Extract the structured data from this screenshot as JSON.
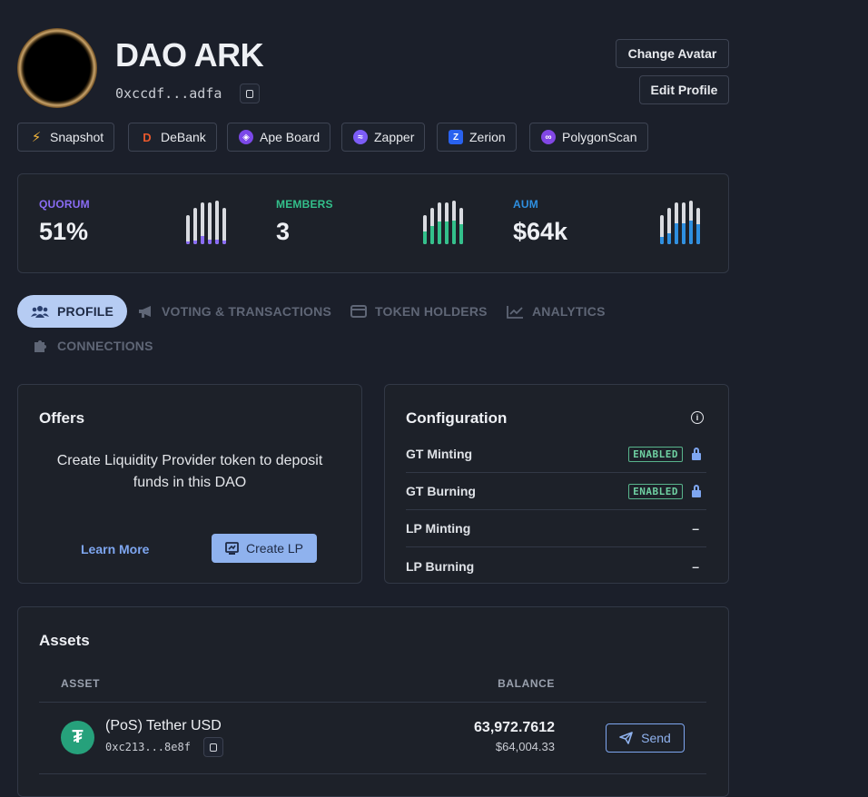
{
  "dao": {
    "title": "DAO ARK",
    "address": "0xccdf...adfa"
  },
  "header_buttons": {
    "change_avatar": "Change Avatar",
    "edit_profile": "Edit Profile"
  },
  "links": [
    {
      "label": "Snapshot",
      "icon": "lightning-icon",
      "color": "#f5b73b"
    },
    {
      "label": "DeBank",
      "icon": "debank-icon",
      "color": "#e8582c"
    },
    {
      "label": "Ape Board",
      "icon": "ape-board-icon",
      "color": "#7b48e8"
    },
    {
      "label": "Zapper",
      "icon": "zapper-icon",
      "color": "#7c5cf6"
    },
    {
      "label": "Zerion",
      "icon": "zerion-icon",
      "color": "#2962ef"
    },
    {
      "label": "PolygonScan",
      "icon": "polygon-icon",
      "color": "#8247e5"
    }
  ],
  "stats": [
    {
      "label": "QUORUM",
      "value": "51%",
      "color": "#8a6cf5",
      "bar_fill": [
        0.1,
        0.1,
        0.2,
        0.1,
        0.1,
        0.1
      ]
    },
    {
      "label": "MEMBERS",
      "value": "3",
      "color": "#33c08b",
      "bar_fill": [
        0.45,
        0.5,
        0.55,
        0.55,
        0.55,
        0.55
      ]
    },
    {
      "label": "AUM",
      "value": "$64k",
      "color": "#2e8fe0",
      "bar_fill": [
        0.25,
        0.3,
        0.5,
        0.5,
        0.55,
        0.55
      ]
    }
  ],
  "tabs": [
    {
      "label": "PROFILE",
      "icon": "users-icon",
      "active": true
    },
    {
      "label": "VOTING & TRANSACTIONS",
      "icon": "megaphone-icon",
      "active": false
    },
    {
      "label": "TOKEN HOLDERS",
      "icon": "wallet-icon",
      "active": false
    },
    {
      "label": "ANALYTICS",
      "icon": "chart-icon",
      "active": false
    },
    {
      "label": "CONNECTIONS",
      "icon": "puzzle-icon",
      "active": false
    }
  ],
  "offers": {
    "title": "Offers",
    "description": "Create Liquidity Provider token to deposit funds in this DAO",
    "learn_more": "Learn More",
    "create_lp": "Create LP"
  },
  "configuration": {
    "title": "Configuration",
    "rows": [
      {
        "label": "GT Minting",
        "status": "ENABLED"
      },
      {
        "label": "GT Burning",
        "status": "ENABLED"
      },
      {
        "label": "LP Minting",
        "status": "–"
      },
      {
        "label": "LP Burning",
        "status": "–"
      }
    ]
  },
  "assets": {
    "title": "Assets",
    "col_asset": "ASSET",
    "col_balance": "BALANCE",
    "rows": [
      {
        "name": "(PoS) Tether USD",
        "address": "0xc213...8e8f",
        "balance": "63,972.7612",
        "usd": "$64,004.33",
        "send": "Send",
        "token_color": "#26a17b"
      }
    ]
  }
}
